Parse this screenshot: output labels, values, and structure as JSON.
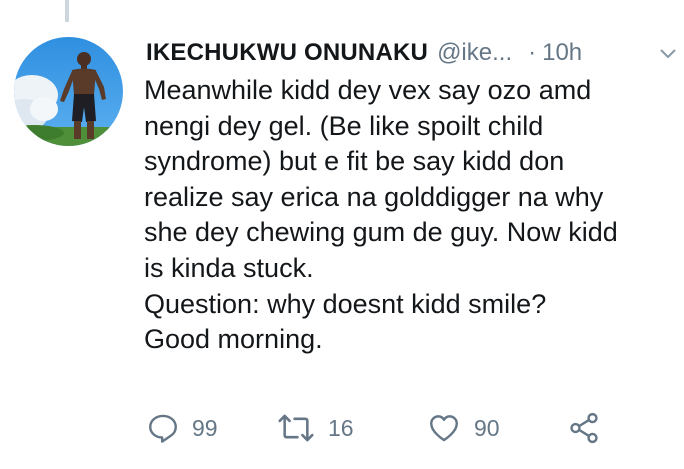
{
  "tweet": {
    "author": {
      "display_name": "IKECHUKWU ONUNAKU",
      "handle": "@ike...",
      "avatar_icon": "profile-photo"
    },
    "separator": "·",
    "time": "10h",
    "lines": [
      "Meanwhile kidd dey vex say ozo amd",
      "nengi dey gel. (Be like spoilt child",
      "syndrome) but e fit be say kidd don",
      "realize say erica na golddigger na why",
      "she dey chewing gum de guy.  Now kidd",
      "is kinda stuck.",
      "Question: why doesnt kidd smile?",
      "Good morning."
    ],
    "actions": {
      "reply": {
        "icon": "reply-icon",
        "count": "99"
      },
      "retweet": {
        "icon": "retweet-icon",
        "count": "16"
      },
      "like": {
        "icon": "like-icon",
        "count": "90"
      },
      "share": {
        "icon": "share-icon"
      }
    }
  },
  "colors": {
    "text": "#14171a",
    "secondary": "#657786",
    "thread_line": "#ccd6dd"
  }
}
